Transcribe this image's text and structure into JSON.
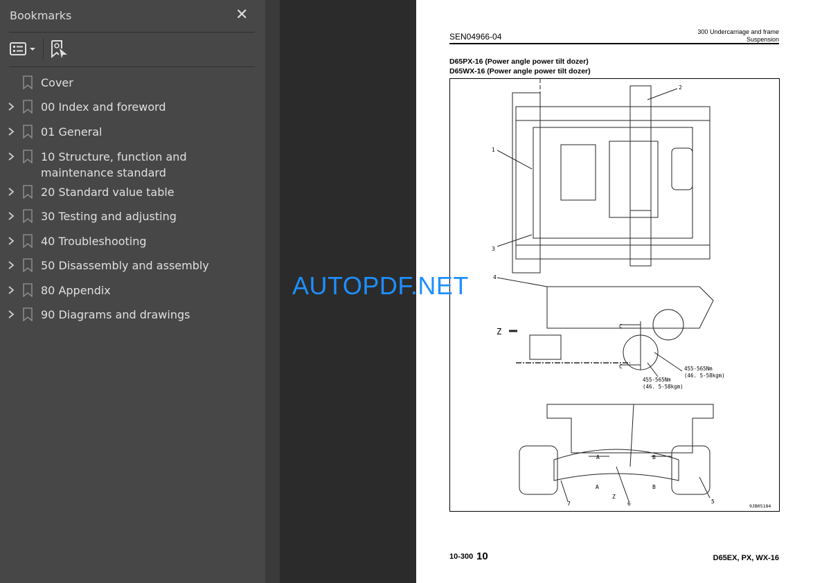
{
  "sidebar": {
    "title": "Bookmarks",
    "close_icon": "close-icon",
    "toolbar": {
      "view_options_icon": "list-view-icon",
      "find_bookmark_icon": "find-bookmark-icon"
    },
    "items": [
      {
        "label": "Cover",
        "expandable": false
      },
      {
        "label": "00 Index and foreword",
        "expandable": true
      },
      {
        "label": "01 General",
        "expandable": true
      },
      {
        "label": "10 Structure, function and maintenance standard",
        "expandable": true
      },
      {
        "label": "20 Standard value table",
        "expandable": true
      },
      {
        "label": "30 Testing and adjusting",
        "expandable": true
      },
      {
        "label": "40 Troubleshooting",
        "expandable": true
      },
      {
        "label": "50 Disassembly and assembly",
        "expandable": true
      },
      {
        "label": "80 Appendix",
        "expandable": true
      },
      {
        "label": "90 Diagrams and drawings",
        "expandable": true
      }
    ]
  },
  "watermark": {
    "text": "AUTOPDF.NET",
    "color": "#1e8fff"
  },
  "page": {
    "doc_number": "SEN04966-04",
    "section_line1": "300 Undercarriage and frame",
    "section_line2": "Suspension",
    "title1": "D65PX-16 (Power angle power tilt dozer)",
    "title2": "D65WX-16 (Power angle power tilt dozer)",
    "drawing": {
      "callouts": [
        "1",
        "2",
        "3",
        "4",
        "5",
        "6",
        "7"
      ],
      "view_z": "Z",
      "section_c": "C",
      "section_a": "A",
      "section_b": "B",
      "torque1": "455-565Nm",
      "torque1_kgm": "(46. 5-58kgm)",
      "torque2": "455-565Nm",
      "torque2_kgm": "(46. 5-58kgm)",
      "figure_id": "9JB05184"
    },
    "footer_page": "10-300",
    "footer_num": "10",
    "footer_model": "D65EX, PX, WX-16"
  }
}
